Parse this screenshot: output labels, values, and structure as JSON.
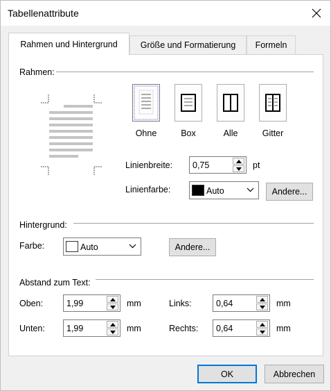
{
  "window": {
    "title": "Tabellenattribute"
  },
  "tabs": [
    {
      "label": "Rahmen und Hintergrund",
      "active": true
    },
    {
      "label": "Größe und Formatierung",
      "active": false
    },
    {
      "label": "Formeln",
      "active": false
    }
  ],
  "borders": {
    "section_label": "Rahmen:",
    "presets": [
      {
        "label": "Ohne",
        "selected": true
      },
      {
        "label": "Box",
        "selected": false
      },
      {
        "label": "Alle",
        "selected": false
      },
      {
        "label": "Gitter",
        "selected": false
      }
    ],
    "line_width": {
      "label": "Linienbreite:",
      "value": "0,75",
      "unit": "pt"
    },
    "line_color": {
      "label": "Linienfarbe:",
      "value": "Auto",
      "swatch": "#000000",
      "more_button": "Andere..."
    }
  },
  "background": {
    "section_label": "Hintergrund:",
    "color": {
      "label": "Farbe:",
      "value": "Auto",
      "swatch": "#ffffff",
      "more_button": "Andere..."
    }
  },
  "spacing": {
    "section_label": "Abstand zum Text:",
    "top": {
      "label": "Oben:",
      "value": "1,99",
      "unit": "mm"
    },
    "bottom": {
      "label": "Unten:",
      "value": "1,99",
      "unit": "mm"
    },
    "left": {
      "label": "Links:",
      "value": "0,64",
      "unit": "mm"
    },
    "right": {
      "label": "Rechts:",
      "value": "0,64",
      "unit": "mm"
    }
  },
  "buttons": {
    "ok": "OK",
    "cancel": "Abbrechen"
  },
  "colors": {
    "accent": "#0078d7",
    "panel": "#ffffff",
    "dialog_bg": "#f0f0f0"
  }
}
